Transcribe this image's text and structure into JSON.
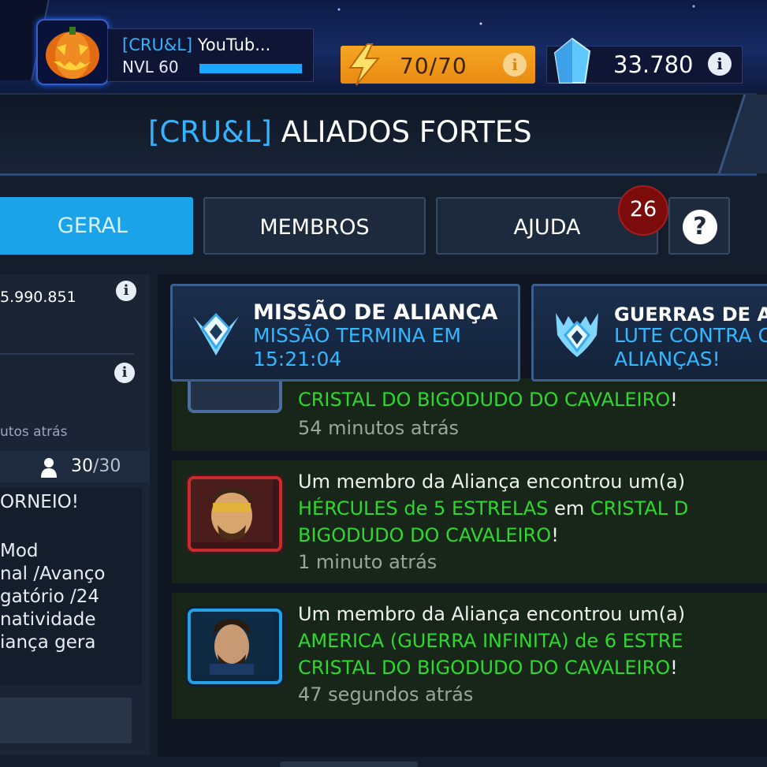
{
  "player": {
    "tag": "[CRU&L]",
    "name": "YouTub...",
    "level_label": "NVL 60",
    "xp_fraction": 1.0
  },
  "energy": {
    "value": "70/70",
    "info_icon": "info-icon"
  },
  "crystals": {
    "value": "33.780",
    "info_icon": "info-icon"
  },
  "alliance": {
    "tag": "[CRU&L]",
    "name": "ALIADOS FORTES"
  },
  "tabs": [
    {
      "label": "GERAL",
      "active": true
    },
    {
      "label": "MEMBROS",
      "active": false
    },
    {
      "label": "AJUDA",
      "active": false
    }
  ],
  "help_badge": "26",
  "help_button_icon": "question-icon",
  "left_panel": {
    "value": "5.990.851",
    "time_ago": "utos atrás",
    "member_count": "30",
    "member_total": "/30",
    "message_lines": [
      "ORNEIO!",
      "",
      "Mod",
      "nal /Avanço",
      "gatório /24",
      "natividade",
      "iança gera"
    ]
  },
  "missions": [
    {
      "title": "MISSÃO DE ALIANÇA",
      "sub1": "MISSÃO TERMINA EM",
      "sub2": "15:21:04"
    },
    {
      "title": "GUERRAS DE A",
      "sub1": "LUTE CONTRA C",
      "sub2": "ALIANÇAS!"
    }
  ],
  "feed": [
    {
      "lines": [
        [
          {
            "text": "CRISTAL DO BIGODUDO DO CAVALEIRO",
            "color": "green"
          },
          {
            "text": "!",
            "color": "white"
          }
        ]
      ],
      "time": "54 minutos atrás"
    },
    {
      "lines": [
        [
          {
            "text": "Um membro da Aliança encontrou um(a)",
            "color": "white"
          }
        ],
        [
          {
            "text": "HÉRCULES de 5 ESTRELAS",
            "color": "green"
          },
          {
            "text": " em ",
            "color": "white"
          },
          {
            "text": "CRISTAL D",
            "color": "green"
          }
        ],
        [
          {
            "text": "BIGODUDO DO CAVALEIRO",
            "color": "green"
          },
          {
            "text": "!",
            "color": "white"
          }
        ]
      ],
      "time": "1 minuto atrás",
      "portrait": "hercules-portrait"
    },
    {
      "lines": [
        [
          {
            "text": "Um membro da Aliança encontrou um(a)",
            "color": "white"
          }
        ],
        [
          {
            "text": "AMERICA (GUERRA INFINITA) de 6 ESTRE",
            "color": "green"
          }
        ],
        [
          {
            "text": "CRISTAL DO BIGODUDO DO CAVALEIRO",
            "color": "green"
          },
          {
            "text": "!",
            "color": "white"
          }
        ]
      ],
      "time": "47 segundos atrás",
      "portrait": "captain-america-portrait"
    }
  ],
  "colors": {
    "accent_blue": "#34b3ff",
    "energy_orange": "#f5a623",
    "feed_green": "#2ed82e",
    "badge_red": "#7c0b0b"
  }
}
